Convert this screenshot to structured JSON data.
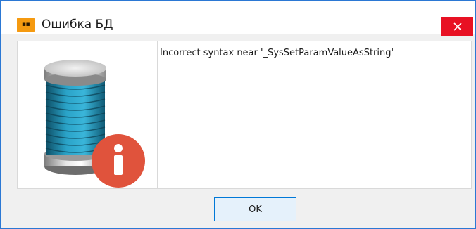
{
  "window": {
    "title": "Ошибка БД",
    "app_icon_text": "▪▪"
  },
  "message": {
    "text": "Incorrect syntax near '_SysSetParamValueAsString'"
  },
  "buttons": {
    "ok_label": "OK"
  },
  "icons": {
    "app": "app-logo-icon",
    "close": "close-icon",
    "database_info": "database-info-icon"
  },
  "colors": {
    "close_red": "#e81123",
    "info_red": "#e0533c",
    "db_teal": "#1f8fb3",
    "accent_blue": "#0078d7",
    "app_orange": "#f59a10"
  }
}
